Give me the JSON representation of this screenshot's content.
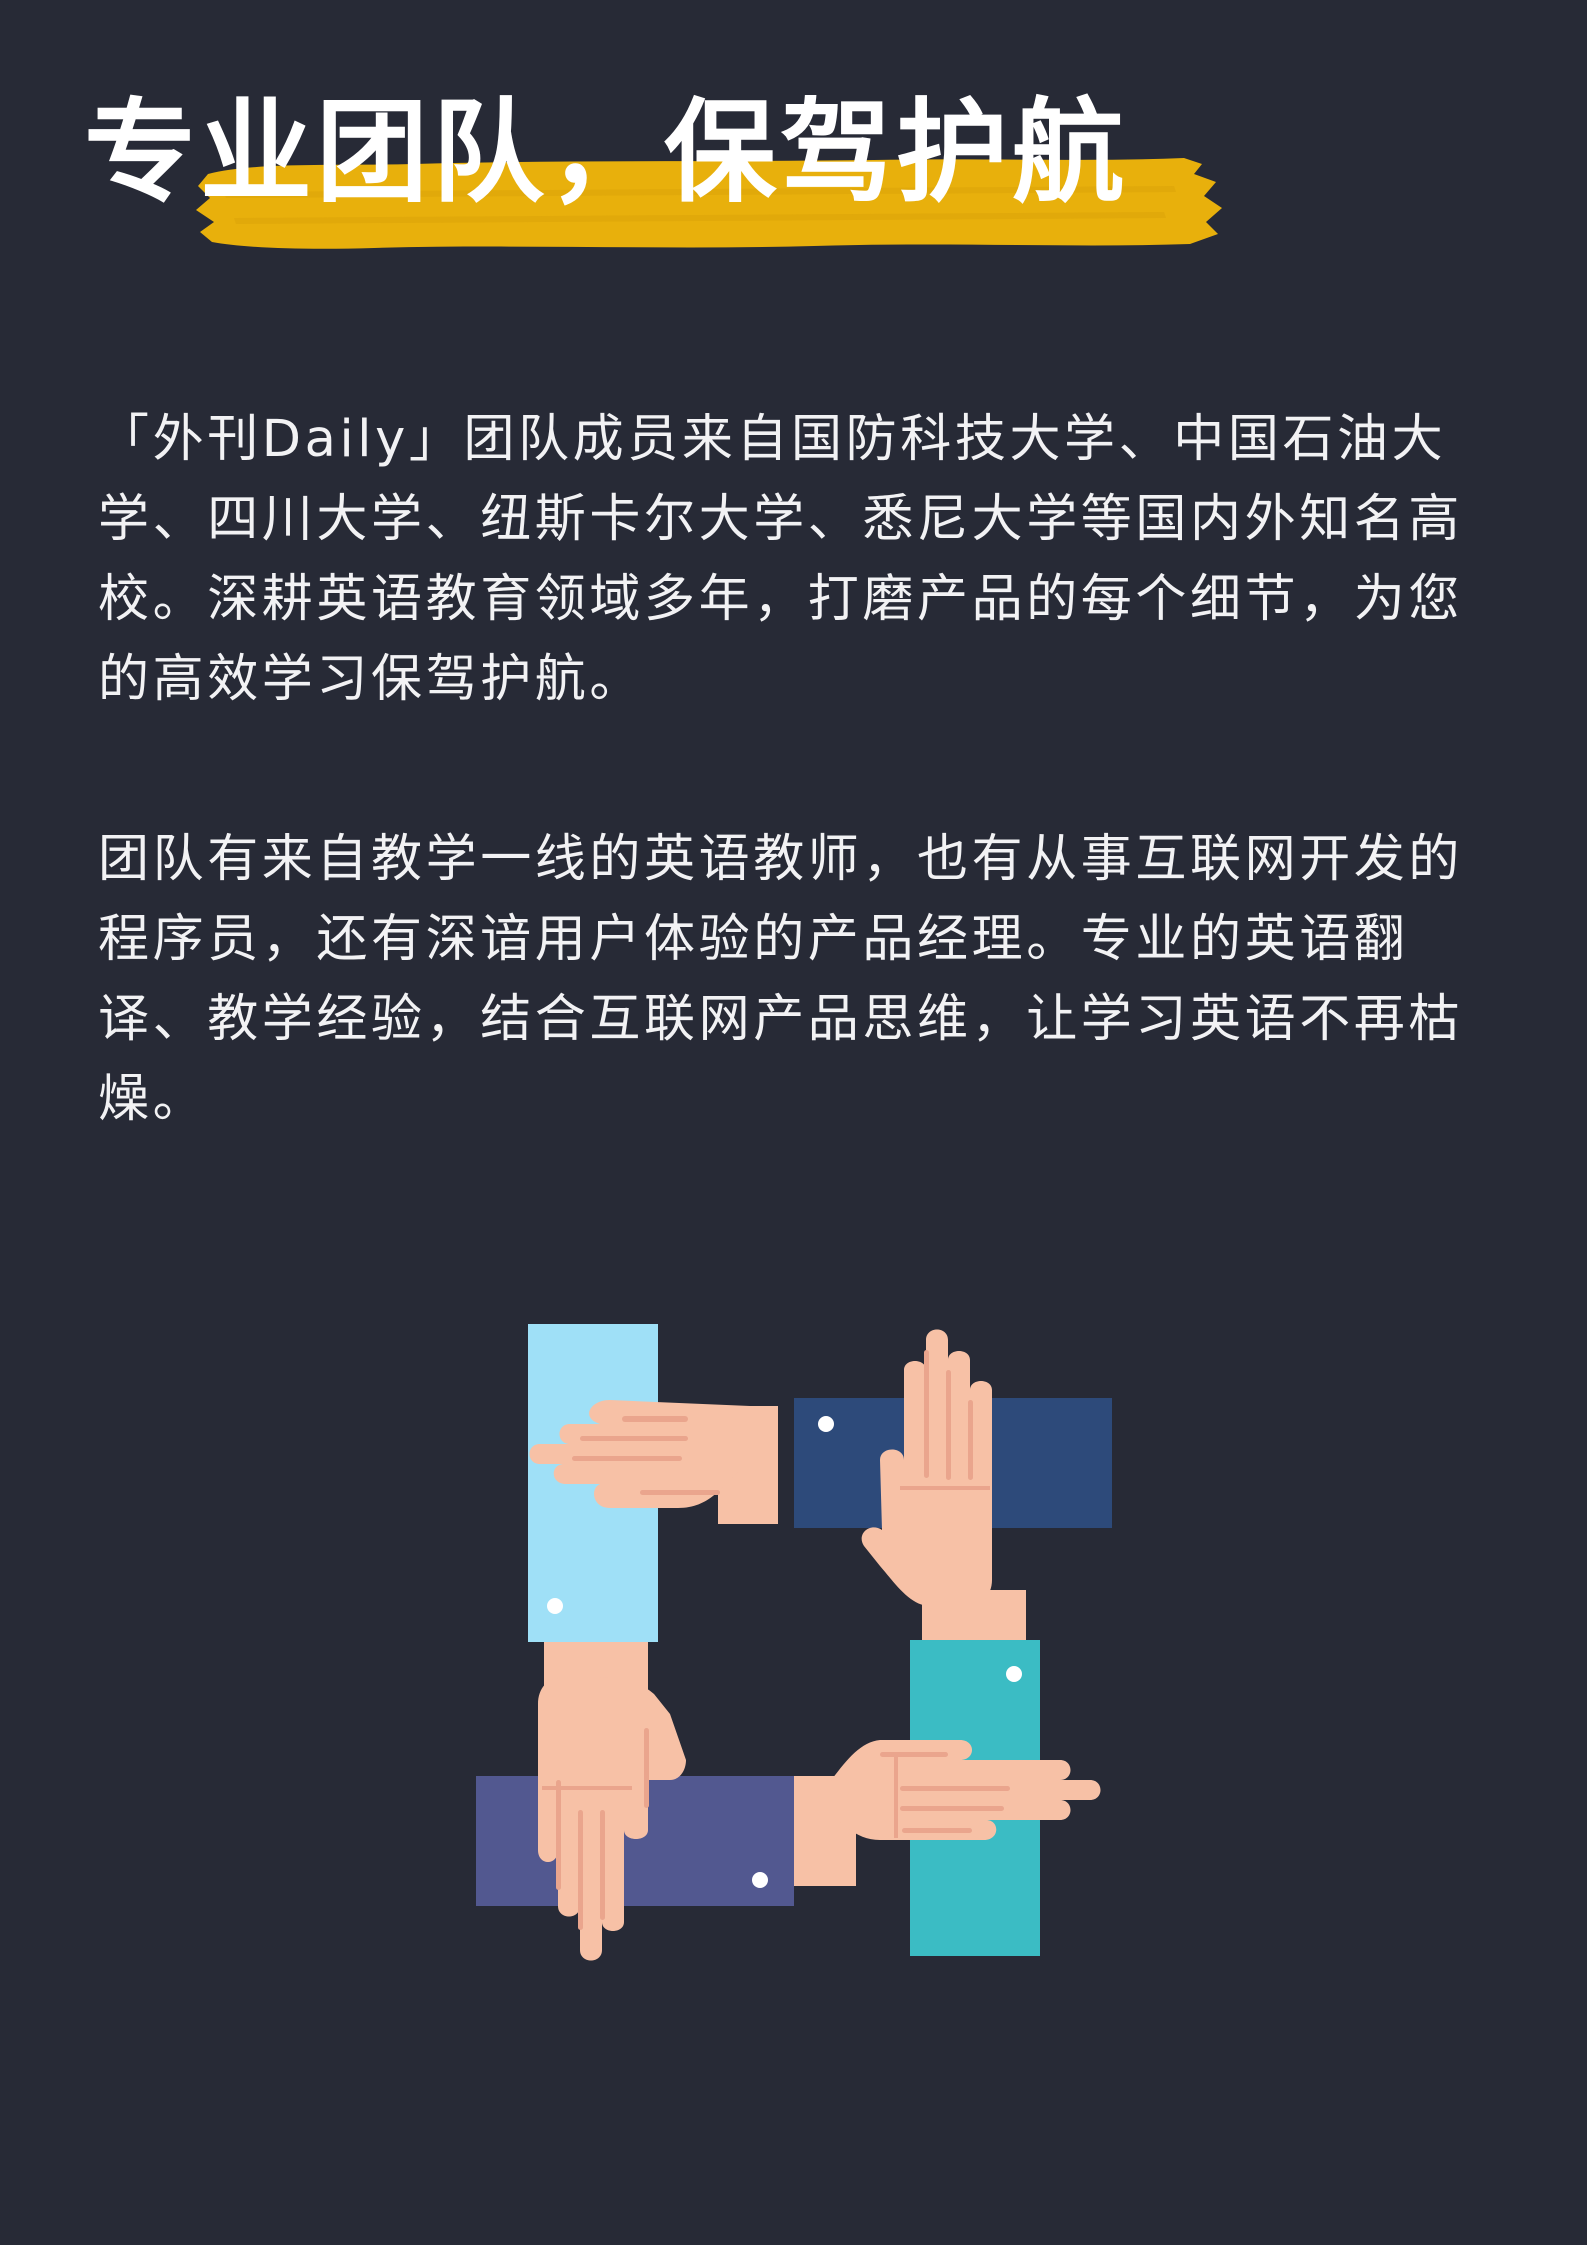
{
  "heading": {
    "title": "专业团队，保驾护航",
    "brush_color": "#e8b00c"
  },
  "paragraphs": [
    {
      "text": "「外刊Daily」团队成员来自国防科技大学、中国石油大学、四川大学、纽斯卡尔大学、悉尼大学等国内外知名高校。深耕英语教育领域多年，打磨产品的每个细节，为您的高效学习保驾护航。"
    },
    {
      "text": "团队有来自教学一线的英语教师，也有从事互联网开发的程序员，还有深谙用户体验的产品经理。专业的英语翻译、教学经验，结合互联网产品思维，让学习英语不再枯燥。"
    }
  ],
  "colors": {
    "background": "#272a36",
    "text": "#f2f2f4",
    "skin": "#f7c1a6",
    "skin_line": "#eaa58d",
    "sleeve_light_blue": "#9fe0f7",
    "sleeve_navy": "#2d4a7a",
    "sleeve_teal": "#3bbcc4",
    "sleeve_indigo": "#525890"
  },
  "illustration": {
    "icon": "teamwork-hands-icon"
  }
}
